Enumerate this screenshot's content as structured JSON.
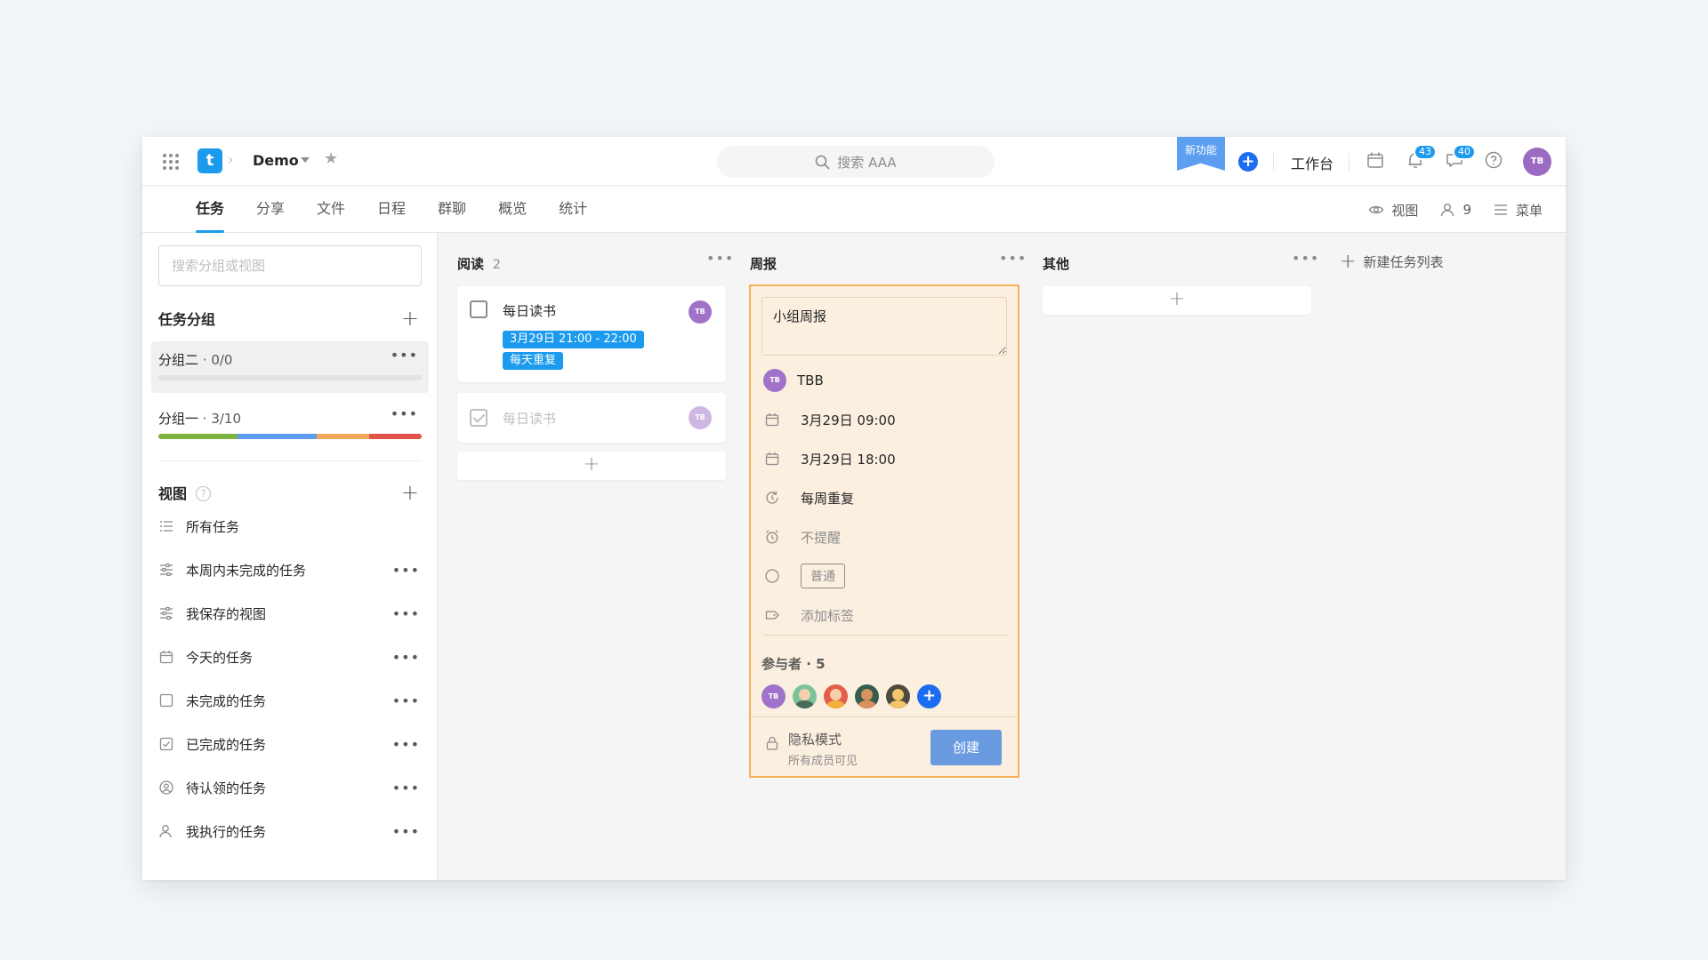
{
  "header": {
    "project_name": "Demo",
    "search_text": "搜索 AAA",
    "new_feature_label": "新功能",
    "workbench_label": "工作台",
    "notification_count": "43",
    "message_count": "40",
    "user_initials": "TB"
  },
  "tabs": [
    {
      "label": "任务",
      "active": true
    },
    {
      "label": "分享"
    },
    {
      "label": "文件"
    },
    {
      "label": "日程"
    },
    {
      "label": "群聊"
    },
    {
      "label": "概览"
    },
    {
      "label": "统计"
    }
  ],
  "tools": {
    "view_label": "视图",
    "member_count": "9",
    "menu_label": "菜单"
  },
  "sidebar": {
    "search_placeholder": "搜索分组或视图",
    "groups_title": "任务分组",
    "groups": [
      {
        "name": "分组二",
        "count": " · 0/0",
        "progress": [],
        "active": true
      },
      {
        "name": "分组一",
        "count": " · 3/10",
        "progress": [
          {
            "fraction": 0.3,
            "color": "#7cb342"
          },
          {
            "fraction": 0.3,
            "color": "#5c9ded"
          },
          {
            "fraction": 0.2,
            "color": "#f2a65a"
          },
          {
            "fraction": 0.2,
            "color": "#e0524a"
          }
        ]
      }
    ],
    "views_title": "视图",
    "views": [
      {
        "label": "所有任务",
        "icon": "list-icon",
        "menu": false
      },
      {
        "label": "本周内未完成的任务",
        "icon": "filter-icon",
        "menu": true
      },
      {
        "label": "我保存的视图",
        "icon": "filter-icon",
        "menu": true
      },
      {
        "label": "今天的任务",
        "icon": "calendar-icon",
        "menu": true
      },
      {
        "label": "未完成的任务",
        "icon": "checkbox-icon",
        "menu": true
      },
      {
        "label": "已完成的任务",
        "icon": "checkbox-checked-icon",
        "menu": true
      },
      {
        "label": "待认领的任务",
        "icon": "user-circle-icon",
        "menu": true
      },
      {
        "label": "我执行的任务",
        "icon": "user-icon",
        "menu": true
      }
    ]
  },
  "board": {
    "columns": [
      {
        "title": "阅读",
        "count": "2"
      },
      {
        "title": "周报",
        "count": ""
      },
      {
        "title": "其他",
        "count": ""
      }
    ],
    "new_list_label": "新建任务列表",
    "cards": [
      {
        "title": "每日读书",
        "date_tag": "3月29日 21:00 - 22:00",
        "repeat_tag": "每天重复",
        "avatar": "TB",
        "done": false
      },
      {
        "title": "每日读书",
        "avatar": "TB",
        "done": true
      }
    ],
    "add_symbol": "+"
  },
  "form": {
    "content": "小组周报",
    "assignee": "TBB",
    "assignee_initials": "TB",
    "start_time": "3月29日 09:00",
    "end_time": "3月29日 18:00",
    "repeat": "每周重复",
    "reminder": "不提醒",
    "priority": "普通",
    "add_tag": "添加标签",
    "participants_label": "参与者 · 5",
    "participant_initials": "TB",
    "privacy_title": "隐私模式",
    "privacy_sub": "所有成员可见",
    "create_label": "创建"
  }
}
